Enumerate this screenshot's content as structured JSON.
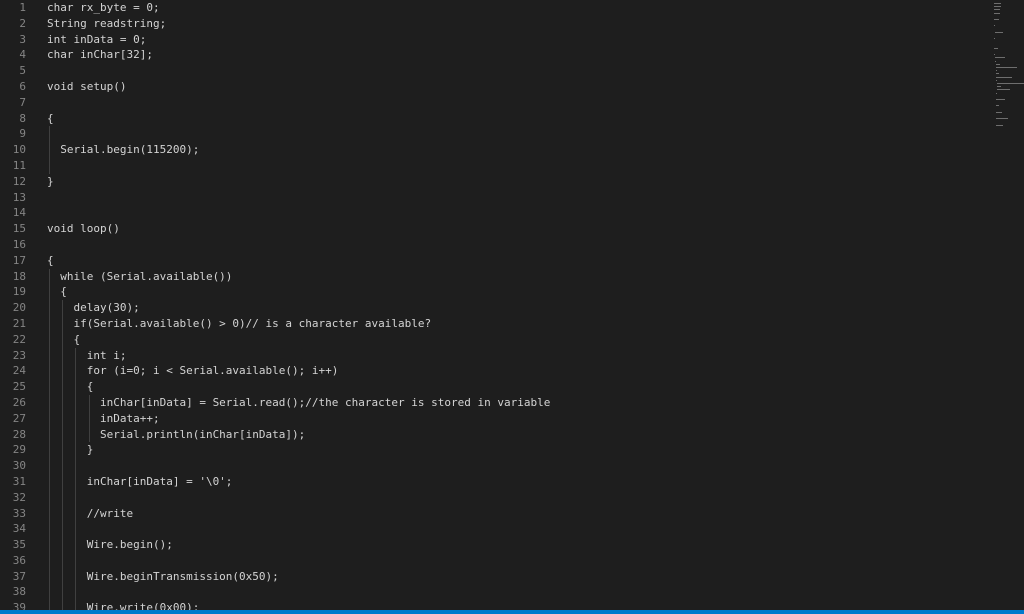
{
  "editor": {
    "lines": [
      {
        "n": "1",
        "text": "char rx_byte = 0;"
      },
      {
        "n": "2",
        "text": "String readstring;"
      },
      {
        "n": "3",
        "text": "int inData = 0;"
      },
      {
        "n": "4",
        "text": "char inChar[32];"
      },
      {
        "n": "5",
        "text": ""
      },
      {
        "n": "6",
        "text": "void setup()"
      },
      {
        "n": "7",
        "text": ""
      },
      {
        "n": "8",
        "text": "{"
      },
      {
        "n": "9",
        "text": ""
      },
      {
        "n": "10",
        "text": "  Serial.begin(115200);"
      },
      {
        "n": "11",
        "text": ""
      },
      {
        "n": "12",
        "text": "}"
      },
      {
        "n": "13",
        "text": ""
      },
      {
        "n": "14",
        "text": ""
      },
      {
        "n": "15",
        "text": "void loop()"
      },
      {
        "n": "16",
        "text": ""
      },
      {
        "n": "17",
        "text": "{"
      },
      {
        "n": "18",
        "text": "  while (Serial.available())"
      },
      {
        "n": "19",
        "text": "  {"
      },
      {
        "n": "20",
        "text": "    delay(30);"
      },
      {
        "n": "21",
        "text": "    if(Serial.available() > 0)// is a character available?"
      },
      {
        "n": "22",
        "text": "    {"
      },
      {
        "n": "23",
        "text": "      int i;"
      },
      {
        "n": "24",
        "text": "      for (i=0; i < Serial.available(); i++)"
      },
      {
        "n": "25",
        "text": "      {"
      },
      {
        "n": "26",
        "text": "        inChar[inData] = Serial.read();//the character is stored in variable"
      },
      {
        "n": "27",
        "text": "        inData++;"
      },
      {
        "n": "28",
        "text": "        Serial.println(inChar[inData]);"
      },
      {
        "n": "29",
        "text": "      }"
      },
      {
        "n": "30",
        "text": ""
      },
      {
        "n": "31",
        "text": "      inChar[inData] = '\\0';"
      },
      {
        "n": "32",
        "text": ""
      },
      {
        "n": "33",
        "text": "      //write"
      },
      {
        "n": "34",
        "text": ""
      },
      {
        "n": "35",
        "text": "      Wire.begin();"
      },
      {
        "n": "36",
        "text": ""
      },
      {
        "n": "37",
        "text": "      Wire.beginTransmission(0x50);"
      },
      {
        "n": "38",
        "text": ""
      },
      {
        "n": "39",
        "text": "      Wire.write(0x00);"
      }
    ]
  },
  "theme": {
    "background": "#1e1e1e",
    "text": "#d4d4d4",
    "line_number": "#858585",
    "accent": "#007acc"
  }
}
